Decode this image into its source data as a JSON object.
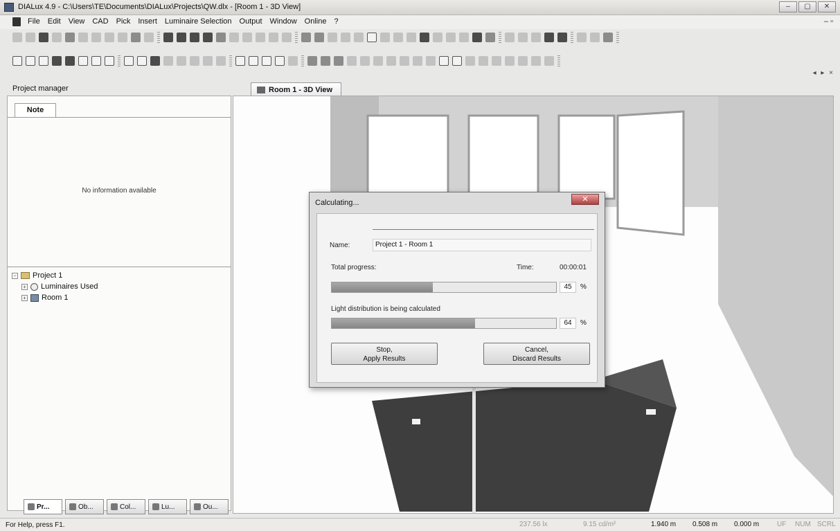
{
  "window": {
    "title": "DIALux 4.9 - C:\\Users\\TE\\Documents\\DIALux\\Projects\\QW.dlx - [Room 1 - 3D View]",
    "controls": [
      "–",
      "▢",
      "✕"
    ],
    "mdi_controls": "– ▫"
  },
  "menu": [
    "File",
    "Edit",
    "View",
    "CAD",
    "Pick",
    "Insert",
    "Luminaire Selection",
    "Output",
    "Window",
    "Online",
    "?"
  ],
  "project_manager": {
    "title": "Project manager",
    "note_tab": "Note",
    "note_text": "No information available",
    "tree": [
      {
        "label": "Project 1",
        "icon": "folder-icon",
        "expander": "−"
      },
      {
        "label": "Luminaires Used",
        "icon": "luminaire-icon",
        "expander": "+"
      },
      {
        "label": "Room 1",
        "icon": "room-icon",
        "expander": "+"
      }
    ],
    "bottom_tabs": [
      "Pr...",
      "Ob...",
      "Col...",
      "Lu...",
      "Ou..."
    ]
  },
  "document_tab": "Room 1 - 3D View",
  "dock_arrows": "◂ ▸ ×",
  "dialog": {
    "title": "Calculating...",
    "close": "✕",
    "name_label": "Name:",
    "name_value": "Project 1 - Room 1",
    "total_label": "Total progress:",
    "time_label": "Time:",
    "time_value": "00:00:01",
    "total_percent": 45,
    "total_percent_text": "45",
    "step_label": "Light distribution is being calculated",
    "step_percent": 64,
    "step_percent_text": "64",
    "percent_sign": "%",
    "stop_button": "Stop,\nApply Results",
    "cancel_button": "Cancel,\nDiscard Results"
  },
  "status": {
    "help": "For Help, press F1.",
    "lux": "237.56 lx",
    "luminance": "9.15 cd/m²",
    "x": "1.940 m",
    "y": "0.508 m",
    "z": "0.000 m",
    "flags": [
      "UF",
      "NUM",
      "SCRL"
    ]
  },
  "colors": {
    "progress_fill": "#8f8f8f",
    "floor": "#3e3e3e",
    "dialog_bg": "#dcdcdc"
  }
}
